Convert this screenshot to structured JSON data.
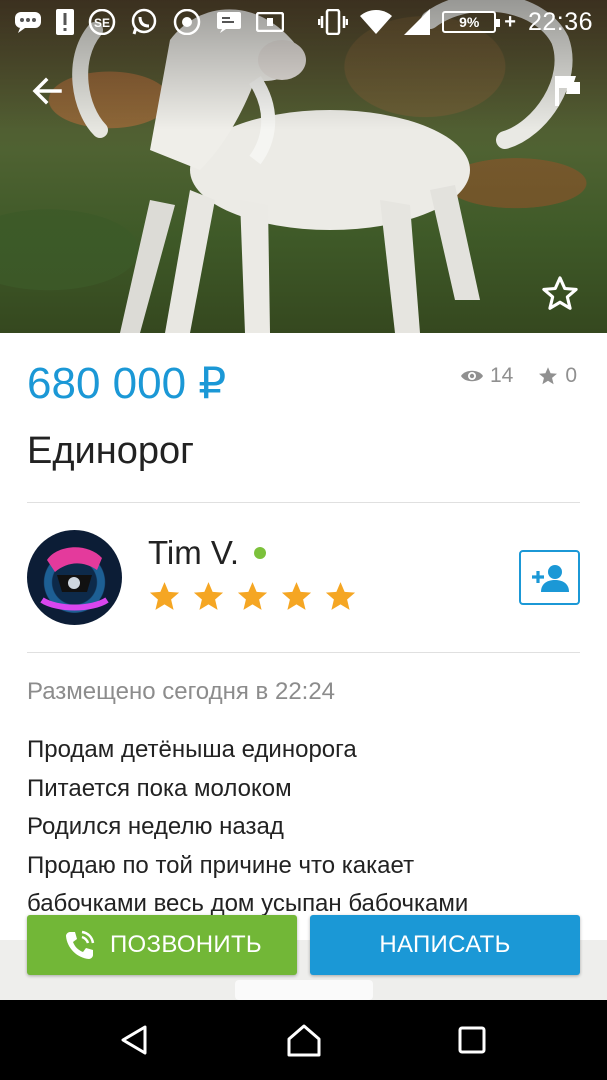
{
  "status_bar": {
    "time": "22:36",
    "battery_percent": "9%",
    "icons": [
      "chat-icon",
      "alert-icon",
      "sim-icon",
      "whatsapp-icon",
      "camera-icon",
      "message-icon",
      "sd-card-icon",
      "vibrate-icon",
      "wifi-icon",
      "signal-icon",
      "battery-charging-icon"
    ]
  },
  "listing": {
    "price": "680 000 ₽",
    "views": "14",
    "favorites": "0",
    "title": "Единорог"
  },
  "seller": {
    "name": "Tim V.",
    "online": true,
    "rating": 5,
    "rating_max": 5
  },
  "posted": "Размещено сегодня в 22:24",
  "description": [
    "Продам детёныша единорога",
    "Питается пока молоком",
    "Родился неделю назад",
    "Продаю по той причине что какает",
    "бабочками весь дом усыпан бабочками"
  ],
  "actions": {
    "call": "ПОЗВОНИТЬ",
    "write": "НАПИСАТЬ"
  },
  "colors": {
    "accent_blue": "#1b98d6",
    "call_green": "#72b737",
    "star_orange": "#f5a623",
    "online_green": "#7cc13b"
  }
}
